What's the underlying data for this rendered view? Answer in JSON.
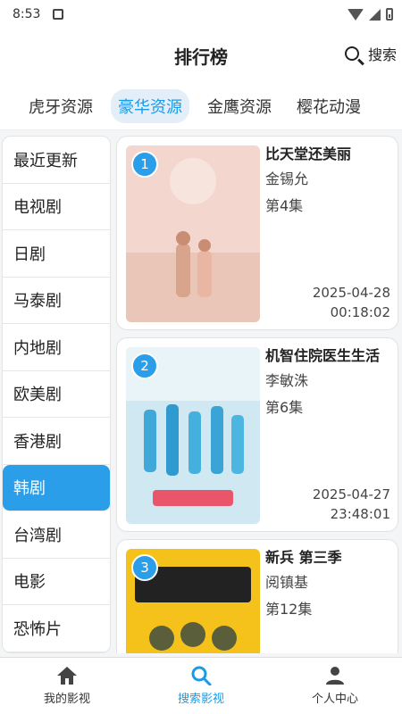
{
  "status": {
    "time": "8:53"
  },
  "header": {
    "title": "排行榜",
    "search_label": "搜索"
  },
  "source_tabs": [
    {
      "label": "虎牙资源"
    },
    {
      "label": "豪华资源"
    },
    {
      "label": "金鹰资源"
    },
    {
      "label": "樱花动漫"
    }
  ],
  "active_source": 1,
  "categories": [
    {
      "label": "最近更新"
    },
    {
      "label": "电视剧"
    },
    {
      "label": "日剧"
    },
    {
      "label": "马泰剧"
    },
    {
      "label": "内地剧"
    },
    {
      "label": "欧美剧"
    },
    {
      "label": "香港剧"
    },
    {
      "label": "韩剧"
    },
    {
      "label": "台湾剧"
    },
    {
      "label": "电影"
    },
    {
      "label": "恐怖片"
    }
  ],
  "active_category": 7,
  "items": [
    {
      "rank": "1",
      "title": "比天堂还美丽",
      "actor": "金锡允",
      "episode": "第4集",
      "date": "2025-04-28",
      "time": "00:18:02",
      "poster_color": "#f3d6cd"
    },
    {
      "rank": "2",
      "title": "机智住院医生生活",
      "actor": "李敏洙",
      "episode": "第6集",
      "date": "2025-04-27",
      "time": "23:48:01",
      "poster_color": "#9fd3ea"
    },
    {
      "rank": "3",
      "title": "新兵 第三季",
      "actor": "阅镇基",
      "episode": "第12集",
      "date": "",
      "time": "",
      "poster_color": "#f4c21a"
    }
  ],
  "bottom_nav": [
    {
      "label": "我的影视",
      "icon": "home-icon"
    },
    {
      "label": "搜索影视",
      "icon": "search-icon"
    },
    {
      "label": "个人中心",
      "icon": "user-icon"
    }
  ],
  "active_nav": 1
}
